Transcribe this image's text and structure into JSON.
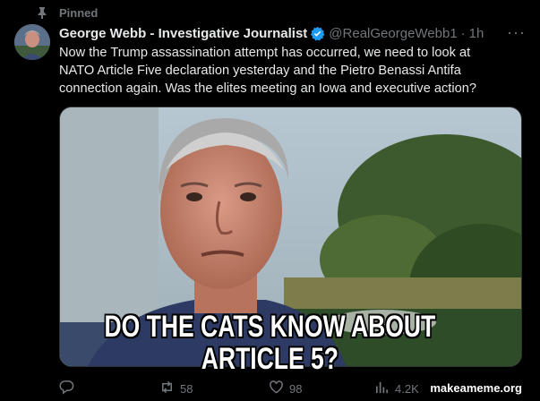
{
  "pinned": {
    "label": "Pinned",
    "icon": "pin-icon"
  },
  "author": {
    "name": "George Webb - Investigative Journalist",
    "verified": true,
    "verified_color": "#1d9bf0",
    "handle": "@RealGeorgeWebb1",
    "separator": "·",
    "time": "1h"
  },
  "more_icon": "more-icon",
  "tweet": {
    "text_line1": "Now the Trump assassination attempt has occurred, we need to look at",
    "text_line2": "NATO Article Five declaration yesterday and the Pietro Benassi Antifa",
    "text_line3": "connection again. Was the elites meeting an Iowa and executive action?"
  },
  "meme": {
    "line1": "DO THE CATS KNOW ABOUT",
    "line2": "ARTICLE 5?"
  },
  "actions": {
    "reply": {
      "icon": "reply-icon",
      "count": ""
    },
    "repost": {
      "icon": "repost-icon",
      "count": "58"
    },
    "like": {
      "icon": "heart-icon",
      "count": "98"
    },
    "views": {
      "icon": "views-icon",
      "count": "4.2K"
    }
  },
  "watermark": "makeameme.org",
  "colors": {
    "background": "#000000",
    "text": "#e7e9ea",
    "muted": "#71767b",
    "accent": "#1d9bf0"
  }
}
